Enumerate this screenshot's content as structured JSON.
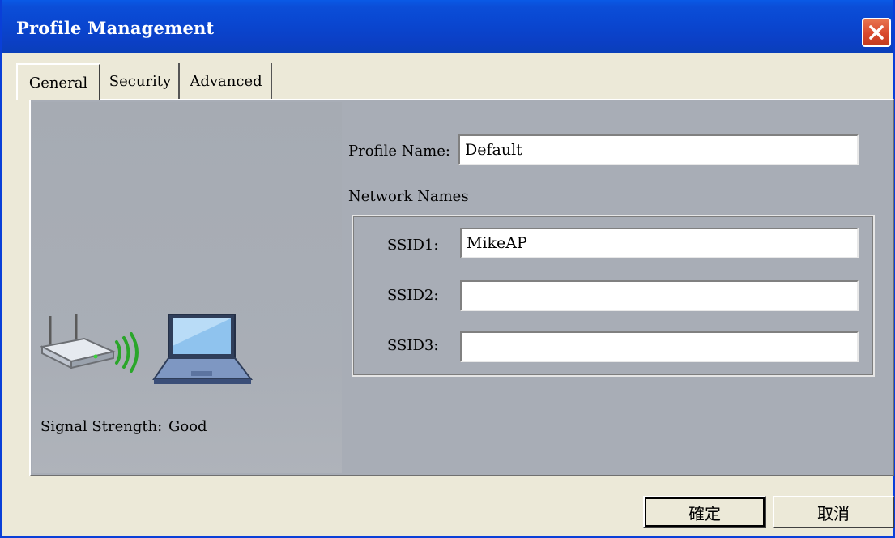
{
  "window": {
    "title": "Profile Management"
  },
  "tabs": [
    {
      "label": "General",
      "active": true
    },
    {
      "label": "Security",
      "active": false
    },
    {
      "label": "Advanced",
      "active": false
    }
  ],
  "general": {
    "profile_name_label": "Profile Name:",
    "profile_name_value": "Default",
    "network_names_label": "Network Names",
    "ssids": [
      {
        "label": "SSID1:",
        "value": "MikeAP"
      },
      {
        "label": "SSID2:",
        "value": ""
      },
      {
        "label": "SSID3:",
        "value": ""
      }
    ],
    "signal_strength_label": "Signal Strength:",
    "signal_strength_value": "Good"
  },
  "buttons": {
    "ok_label": "確定",
    "cancel_label": "取消"
  },
  "icons": {
    "router": "router-icon",
    "signal": "wireless-signal-icon",
    "laptop": "laptop-icon",
    "close": "close-icon"
  },
  "colors": {
    "title_bar": "#0a46d0",
    "close_button": "#d9482d",
    "panel_bg": "#a8adb6",
    "dialog_bg": "#ece9d8",
    "signal_green": "#2aa62a"
  }
}
